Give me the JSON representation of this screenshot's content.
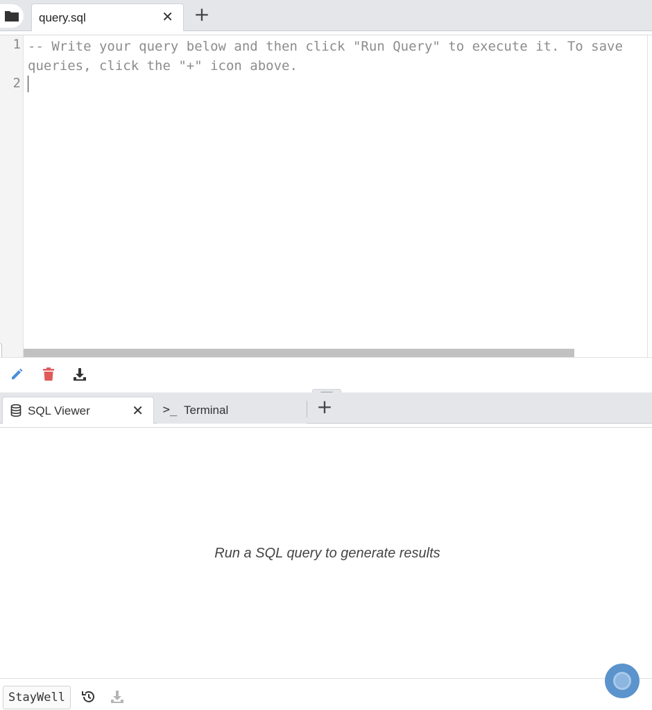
{
  "editor_tabs": {
    "active_file": "query.sql",
    "close_glyph": "✕",
    "add_glyph": "+"
  },
  "editor": {
    "line_numbers": [
      "1",
      "2"
    ],
    "lines": [
      "-- Write your query below and then click \"Run Query\" to execute it. To save",
      "queries, click the \"+\" icon above."
    ]
  },
  "toolbar": {
    "icons": [
      "pencil-icon",
      "trash-icon",
      "download-icon"
    ],
    "colors": {
      "pencil": "#4a90d9",
      "trash": "#e05a5a",
      "download": "#333333"
    }
  },
  "panel_tabs": [
    {
      "label": "SQL Viewer",
      "icon": "database-icon",
      "active": true,
      "close_glyph": "✕"
    },
    {
      "label": "Terminal",
      "icon": "terminal-icon",
      "icon_text": ">_",
      "active": false
    }
  ],
  "panel_add_glyph": "+",
  "results": {
    "empty_message": "Run a SQL query to generate results"
  },
  "footer": {
    "database": "StayWell",
    "icons": [
      "history-icon",
      "download-icon"
    ]
  },
  "assistant": {
    "icon": "assistant-icon",
    "color": "#5b93cc"
  }
}
